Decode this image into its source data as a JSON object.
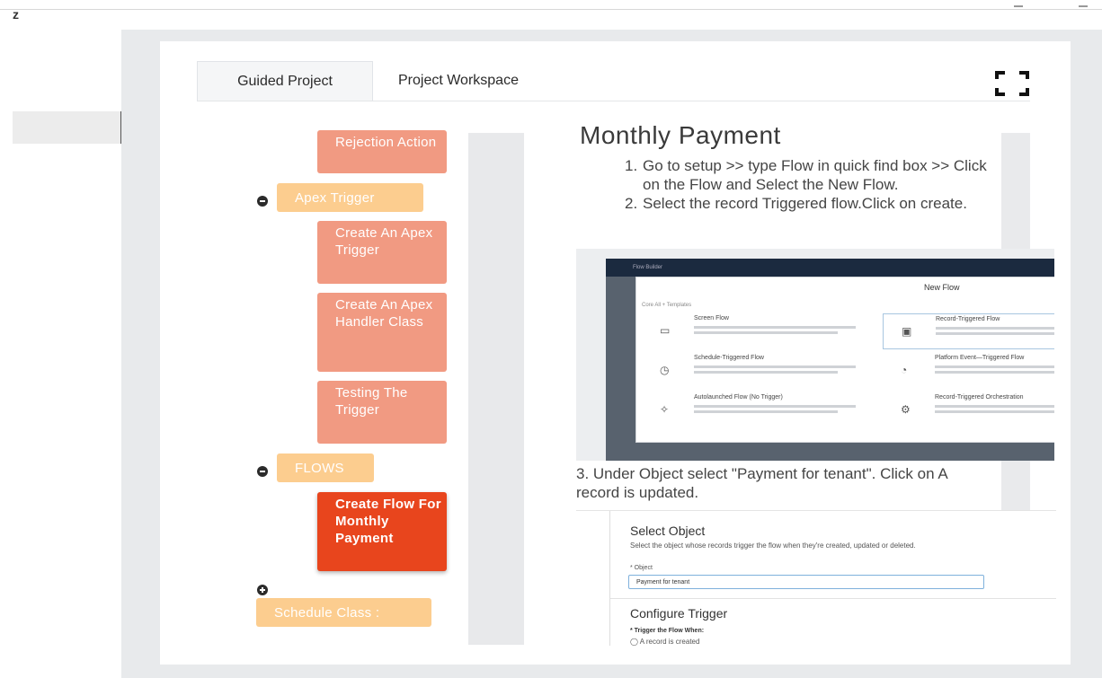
{
  "header": {
    "corner_letter": "z"
  },
  "tabs": [
    {
      "label": "Guided Project",
      "active": true
    },
    {
      "label": "Project Workspace",
      "active": false
    }
  ],
  "icons": {
    "expand": "fullscreen-expand-icon",
    "collapse": "minus-circle-icon",
    "expand_section": "plus-circle-icon"
  },
  "nav": {
    "rejection_action": "Rejection Action",
    "apex_trigger": "Apex Trigger",
    "create_apex_trigger": "Create An Apex Trigger",
    "create_apex_handler": "Create An Apex Handler Class",
    "testing_trigger": "Testing The Trigger",
    "flows": "FLOWS",
    "create_flow": "Create Flow For Monthly Payment",
    "schedule_class": "Schedule Class :"
  },
  "colors": {
    "step": "#f19a82",
    "section": "#fccd8f",
    "active": "#e8451d"
  },
  "content": {
    "heading": "Monthly Payment",
    "steps": [
      {
        "num": "1.",
        "text": "Go to setup >> type Flow in quick find box >> Click on the Flow and Select the New Flow."
      },
      {
        "num": "2.",
        "text": "Select the record Triggered flow.Click on create."
      }
    ],
    "step3": "3. Under Object select \"Payment for tenant\". Click on A record is updated."
  },
  "screenshot1": {
    "app_title": "Flow Builder",
    "modal_title": "New Flow",
    "modal_tabs": "Core   All + Templates",
    "options": [
      {
        "title": "Screen Flow",
        "icon": "monitor-icon"
      },
      {
        "title": "Record-Triggered Flow",
        "icon": "record-icon"
      },
      {
        "title": "Schedule-Triggered Flow",
        "icon": "clock-icon"
      },
      {
        "title": "Platform Event—Triggered Flow",
        "icon": "event-icon"
      },
      {
        "title": "Autolaunched Flow (No Trigger)",
        "icon": "wand-icon"
      },
      {
        "title": "Record-Triggered Orchestration",
        "icon": "orchestration-icon"
      }
    ]
  },
  "screenshot2": {
    "title": "Select Object",
    "description": "Select the object whose records trigger the flow when they're created, updated or deleted.",
    "object_label": "* Object",
    "object_value": "Payment for tenant",
    "trigger_title": "Configure Trigger",
    "trigger_label": "* Trigger the Flow When:",
    "option1": "A record is created"
  }
}
